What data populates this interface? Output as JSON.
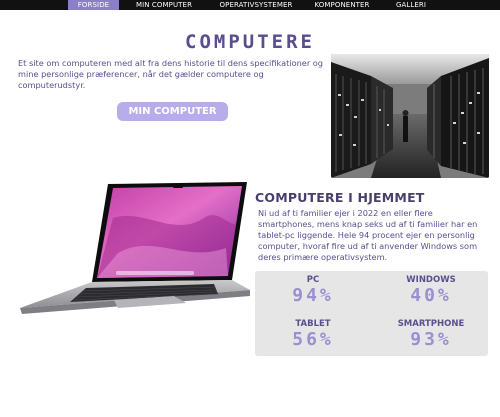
{
  "nav": {
    "items": [
      "FORSIDE",
      "MIN COMPUTER",
      "OPERATIVSYSTEMER",
      "KOMPONENTER",
      "GALLERI"
    ],
    "active": "FORSIDE"
  },
  "hero": {
    "title": "COMPUTERE",
    "text": "Et site om computeren med alt fra dens historie til dens specifikationer og mine personlige præferencer, når det gælder computere og computerudstyr.",
    "button_label": "MIN COMPUTER"
  },
  "home": {
    "title": "COMPUTERE I HJEMMET",
    "text": "Ni ud af ti familier ejer i 2022 en eller flere smartphones, mens knap seks ud af ti familier har en tablet-pc liggende. Hele 94 procent ejer en personlig computer, hvoraf fire ud af ti anvender Windows som deres primære operativsystem."
  },
  "stats": [
    {
      "label": "PC",
      "value": "94%"
    },
    {
      "label": "WINDOWS",
      "value": "40%"
    },
    {
      "label": "TABLET",
      "value": "56%"
    },
    {
      "label": "SMARTPHONE",
      "value": "93%"
    }
  ],
  "colors": {
    "accent": "#8b7fc7",
    "button": "#b8acea",
    "text": "#5b4e8f",
    "stat_value": "#9a8fd0",
    "nav_bg": "#111111",
    "stats_bg": "#e6e6e6"
  },
  "images": {
    "server_photo": "server-room-photo",
    "laptop": "laptop-image"
  }
}
